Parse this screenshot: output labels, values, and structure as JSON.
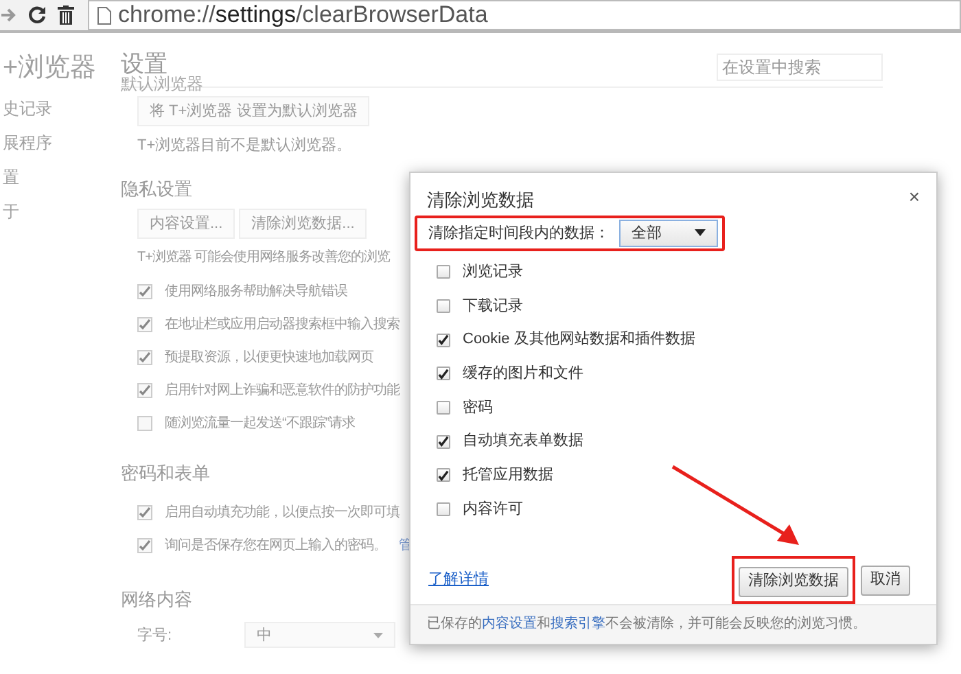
{
  "toolbar": {
    "url": "chrome://**settings**/clearBrowserData"
  },
  "sidebar": {
    "title": "+浏览器",
    "items": [
      "史记录",
      "展程序",
      "置",
      "于"
    ]
  },
  "settings": {
    "title": "设置",
    "search": {
      "placeholder": "在设置中搜索"
    },
    "default_browser": {
      "heading": "默认浏览器",
      "button": "将 T+浏览器 设置为默认浏览器",
      "note": "T+浏览器目前不是默认浏览器。"
    },
    "privacy": {
      "heading": "隐私设置",
      "buttons": [
        "内容设置...",
        "清除浏览数据..."
      ],
      "note": "T+浏览器 可能会使用网络服务改善您的浏览",
      "options": [
        {
          "label": "使用网络服务帮助解决导航错误",
          "checked": true
        },
        {
          "label": "在地址栏或应用启动器搜索框中输入搜索",
          "checked": true
        },
        {
          "label": "预提取资源，以便更快速地加载网页",
          "checked": true
        },
        {
          "label": "启用针对网上诈骗和恶意软件的防护功能",
          "checked": true
        },
        {
          "label": "随浏览流量一起发送“不跟踪”请求",
          "checked": false
        }
      ]
    },
    "passwords": {
      "heading": "密码和表单",
      "options": [
        {
          "label": "启用自动填充功能，以便点按一次即可填",
          "checked": true
        },
        {
          "label": "询问是否保存您在网页上输入的密码。",
          "link": "管",
          "checked": true
        }
      ]
    },
    "web_content": {
      "heading": "网络内容",
      "font_size": {
        "label": "字号:",
        "value": "中"
      }
    }
  },
  "dialog": {
    "title": "清除浏览数据",
    "close": "×",
    "range": {
      "label": "清除指定时间段内的数据：",
      "value": "全部"
    },
    "items": [
      {
        "label": "浏览记录",
        "checked": false
      },
      {
        "label": "下载记录",
        "checked": false
      },
      {
        "label": "Cookie 及其他网站数据和插件数据",
        "checked": true
      },
      {
        "label": "缓存的图片和文件",
        "checked": true
      },
      {
        "label": "密码",
        "checked": false
      },
      {
        "label": "自动填充表单数据",
        "checked": true
      },
      {
        "label": "托管应用数据",
        "checked": true
      },
      {
        "label": "内容许可",
        "checked": false
      }
    ],
    "learn_more": "了解详情",
    "buttons": [
      "清除浏览数据",
      "取消"
    ],
    "footer": [
      {
        "text": "已保存的"
      },
      {
        "text": "内容设置",
        "link": true
      },
      {
        "text": "和"
      },
      {
        "text": "搜索引擎",
        "link": true
      },
      {
        "text": "不会被清除，并可能会反映您的浏览习惯。"
      }
    ]
  }
}
